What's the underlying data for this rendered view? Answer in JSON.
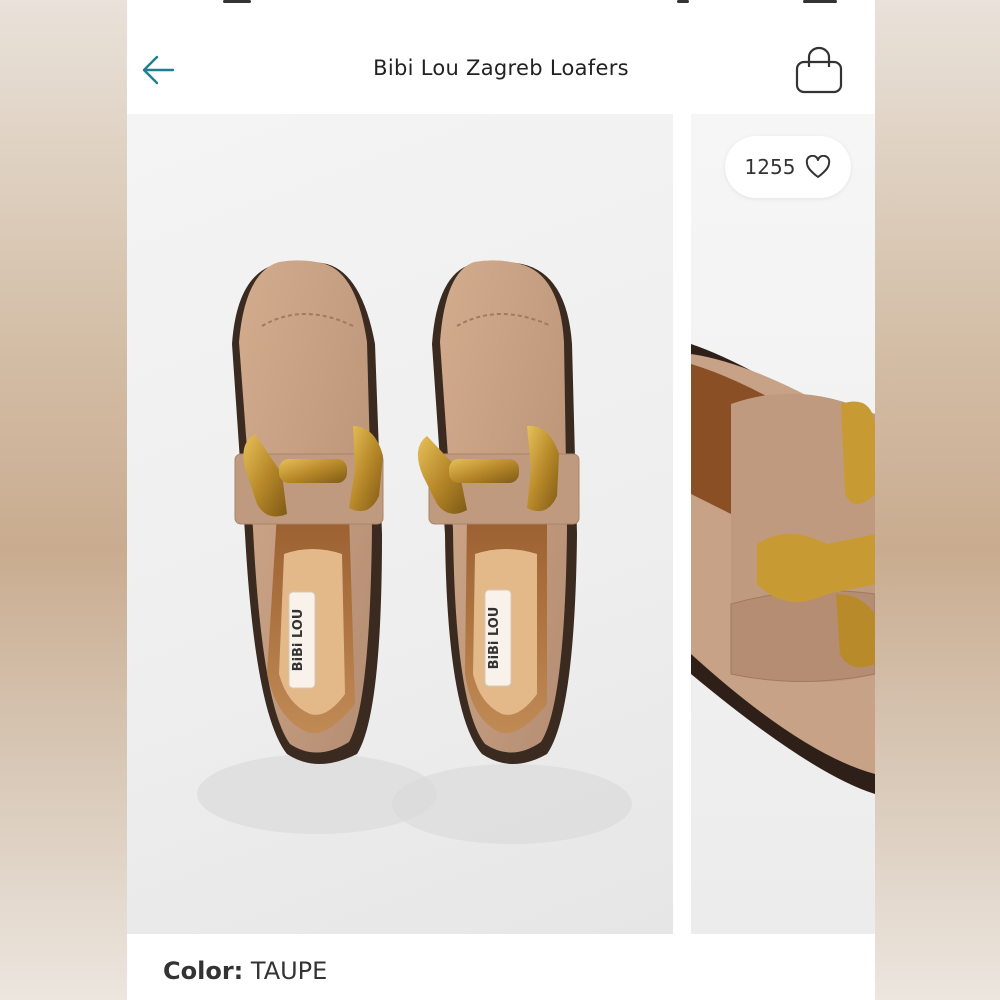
{
  "header": {
    "title": "Bibi Lou Zagreb Loafers",
    "back_icon": "arrow-left-icon",
    "cart_icon": "shopping-bag-icon"
  },
  "product": {
    "like_count": "1255",
    "like_icon": "heart-outline-icon",
    "insole_brand": "BiBi LOU"
  },
  "color": {
    "label": "Color:",
    "value": "TAUPE"
  },
  "colors": {
    "accent": "#1e7f8f",
    "suede": "#c49d80",
    "hardware": "#b98a2a"
  }
}
